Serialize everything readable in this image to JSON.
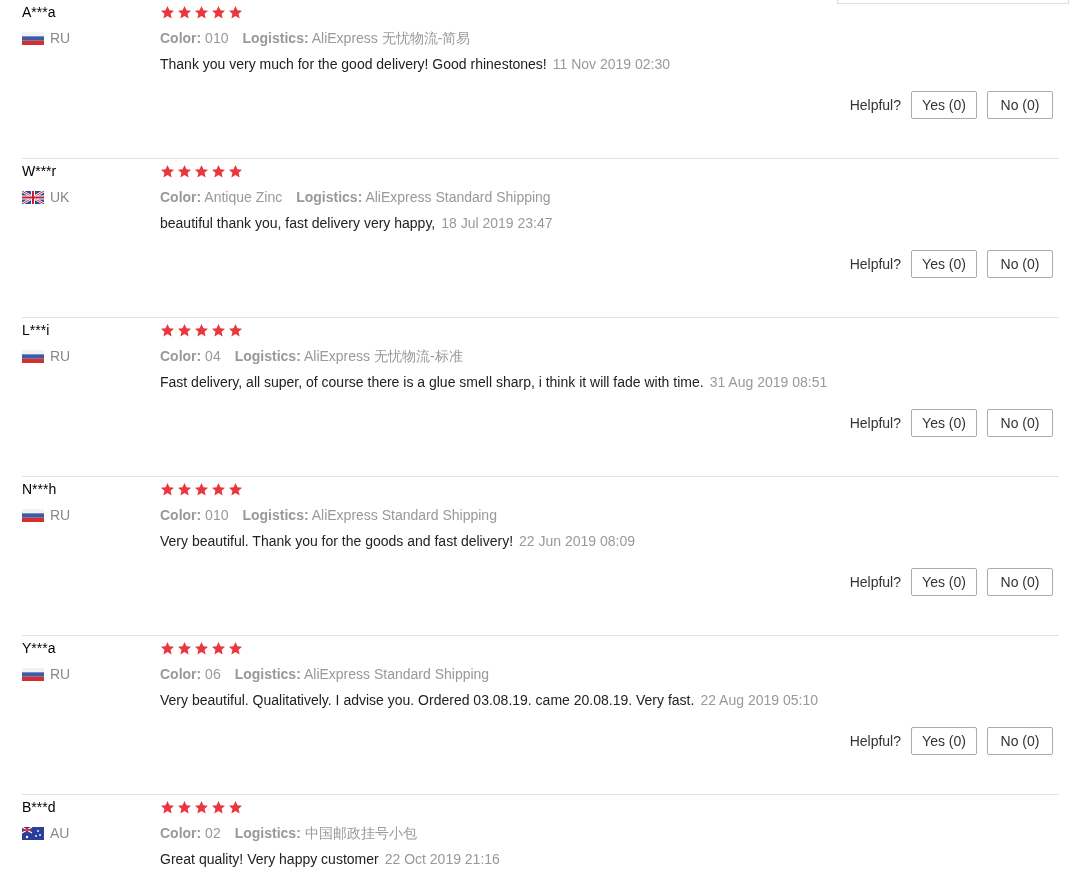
{
  "reviews": [
    {
      "name": "A***a",
      "kind": "ru",
      "country": "RU",
      "stars": 5,
      "color_label": "Color:",
      "color_value": "010",
      "logistics_label": "Logistics:",
      "logistics": "AliExpress 无忧物流-简易",
      "comment": "Thank you very much for the good delivery! Good rhinestones!",
      "date": "11 Nov 2019 02:30",
      "helpful": "Helpful?",
      "yes": "Yes (0)",
      "no": "No (0)"
    },
    {
      "name": "W***r",
      "kind": "uk",
      "country": "UK",
      "stars": 5,
      "color_label": "Color:",
      "color_value": "Antique Zinc",
      "logistics_label": "Logistics:",
      "logistics": "AliExpress Standard Shipping",
      "comment": "beautiful thank you, fast delivery very happy,",
      "date": "18 Jul 2019 23:47",
      "helpful": "Helpful?",
      "yes": "Yes (0)",
      "no": "No (0)"
    },
    {
      "name": "L***i",
      "kind": "ru",
      "country": "RU",
      "stars": 5,
      "color_label": "Color:",
      "color_value": "04",
      "logistics_label": "Logistics:",
      "logistics": "AliExpress 无忧物流-标准",
      "comment": "Fast delivery, all super, of course there is a glue smell sharp, i think it will fade with time.",
      "date": "31 Aug 2019 08:51",
      "helpful": "Helpful?",
      "yes": "Yes (0)",
      "no": "No (0)"
    },
    {
      "name": "N***h",
      "kind": "ru",
      "country": "RU",
      "stars": 5,
      "color_label": "Color:",
      "color_value": "010",
      "logistics_label": "Logistics:",
      "logistics": "AliExpress Standard Shipping",
      "comment": "Very beautiful. Thank you for the goods and fast delivery!",
      "date": "22 Jun 2019 08:09",
      "helpful": "Helpful?",
      "yes": "Yes (0)",
      "no": "No (0)"
    },
    {
      "name": "Y***a",
      "kind": "ru",
      "country": "RU",
      "stars": 5,
      "color_label": "Color:",
      "color_value": "06",
      "logistics_label": "Logistics:",
      "logistics": "AliExpress Standard Shipping",
      "comment": "Very beautiful. Qualitatively. I advise you. Ordered 03.08.19. came 20.08.19. Very fast.",
      "date": "22 Aug 2019 05:10",
      "helpful": "Helpful?",
      "yes": "Yes (0)",
      "no": "No (0)"
    },
    {
      "name": "B***d",
      "kind": "au",
      "country": "AU",
      "stars": 5,
      "color_label": "Color:",
      "color_value": "02",
      "logistics_label": "Logistics:",
      "logistics": "中国邮政挂号小包",
      "comment": "Great quality! Very happy customer",
      "date": "22 Oct 2019 21:16"
    }
  ]
}
